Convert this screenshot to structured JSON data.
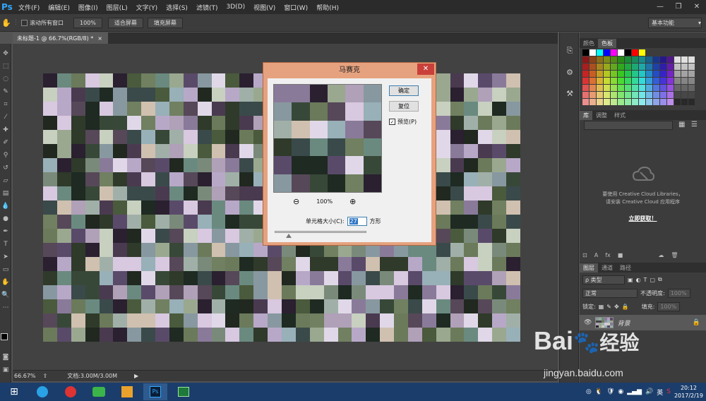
{
  "app": {
    "logo": "Ps"
  },
  "menu": [
    "文件(F)",
    "编辑(E)",
    "图像(I)",
    "图层(L)",
    "文字(Y)",
    "选择(S)",
    "滤镜(T)",
    "3D(D)",
    "视图(V)",
    "窗口(W)",
    "帮助(H)"
  ],
  "window_controls": {
    "minimize": "—",
    "restore": "❐",
    "close": "✕"
  },
  "options": {
    "scroll_all": "滚动所有窗口",
    "zoom": "100%",
    "fit_screen": "适合屏幕",
    "fill_screen": "填充屏幕",
    "workspace": "基本功能"
  },
  "doc_tab": {
    "title": "未标题-1 @ 66.7%(RGB/8) *",
    "close": "×"
  },
  "status": {
    "zoom": "66.67%",
    "doc": "文档:3.00M/3.00M"
  },
  "panels": {
    "color_tabs": [
      "颜色",
      "色板"
    ],
    "lib_tabs": [
      "库",
      "调整",
      "样式"
    ],
    "cc_msg1": "要使用 Creative Cloud Libraries，",
    "cc_msg2": "请安装 Creative Cloud 应用程序",
    "cc_link": "立即获取！",
    "layer_tabs": [
      "图层",
      "通道",
      "路径"
    ],
    "kind": "ρ 类型",
    "blend": "正常",
    "opacity_label": "不透明度:",
    "opacity": "100%",
    "lock_label": "锁定:",
    "fill_label": "填充:",
    "fill": "100%",
    "layer_name": "背景"
  },
  "dialog": {
    "title": "马赛克",
    "close": "✕",
    "ok": "确定",
    "reset": "复位",
    "preview_label": "预览(P)",
    "preview_checked": "✓",
    "zoom_out": "⊖",
    "zoom_level": "100%",
    "zoom_in": "⊕",
    "cell_label": "单元格大小(C):",
    "cell_value": "27",
    "cell_unit": "方形"
  },
  "taskbar": {
    "clock_time": "20:12",
    "clock_date": "2017/2/19",
    "ime": "英"
  },
  "watermark": {
    "text": "Bai𝄆经验",
    "sub": "jingyan.baidu.com"
  },
  "colors": {
    "menubar": "#2b2b2b",
    "dialog_frame": "#e6a27f",
    "taskbar": "#1b3d6b",
    "ps_blue": "#31a8ff"
  }
}
